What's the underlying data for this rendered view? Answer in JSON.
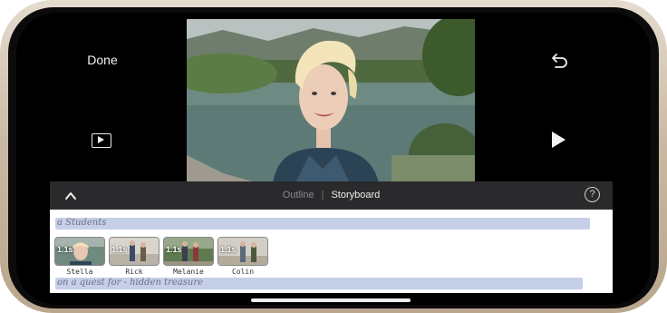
{
  "editor": {
    "done_label": "Done",
    "left_play_icon": "play-preview-icon",
    "undo_icon": "undo-icon",
    "play_icon": "play-icon"
  },
  "tabbar": {
    "collapse_icon": "chevron-up-icon",
    "tabs": [
      {
        "label": "Outline",
        "selected": false
      },
      {
        "label": "Storyboard",
        "selected": true
      }
    ],
    "separator": "|",
    "help_label": "?"
  },
  "storyboard": {
    "top_text": "a Students",
    "bottom_text": "on a quest for - hidden treasure",
    "clips": [
      {
        "duration": "1.1s",
        "name": "Stella"
      },
      {
        "duration": "1.1s",
        "name": "Rick"
      },
      {
        "duration": "1.1s",
        "name": "Melanie"
      },
      {
        "duration": "1.1s",
        "name": "Colin"
      }
    ],
    "stroke_color": "#c5cfe7"
  }
}
